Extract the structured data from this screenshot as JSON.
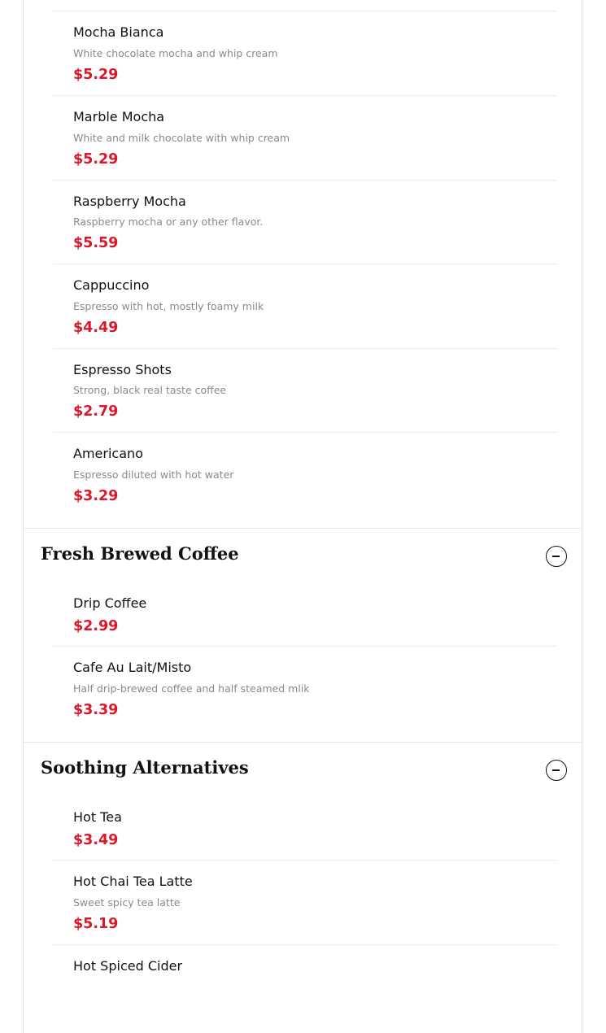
{
  "colors": {
    "price": "#d8182b",
    "text": "#111111",
    "description": "#8a8a8a",
    "divider": "#ececec"
  },
  "espresso_items": [
    {
      "name": "Mocha Bianca",
      "description": "White chocolate mocha and whip cream",
      "price": "$5.29"
    },
    {
      "name": "Marble Mocha",
      "description": "White and milk chocolate with whip cream",
      "price": "$5.29"
    },
    {
      "name": "Raspberry Mocha",
      "description": "Raspberry mocha or any other flavor.",
      "price": "$5.59"
    },
    {
      "name": "Cappuccino",
      "description": "Espresso with hot, mostly foamy milk",
      "price": "$4.49"
    },
    {
      "name": "Espresso Shots",
      "description": "Strong, black real taste coffee",
      "price": "$2.79"
    },
    {
      "name": "Americano",
      "description": "Espresso diluted with hot water",
      "price": "$3.29"
    }
  ],
  "fresh_brewed": {
    "title": "Fresh Brewed Coffee",
    "collapse_icon": "minus-circle-icon",
    "items": [
      {
        "name": "Drip Coffee",
        "price": "$2.99"
      },
      {
        "name": "Cafe Au Lait/Misto",
        "description": "Half drip-brewed coffee and half steamed mlik",
        "price": "$3.39"
      }
    ]
  },
  "soothing": {
    "title": "Soothing Alternatives",
    "collapse_icon": "minus-circle-icon",
    "items": [
      {
        "name": "Hot Tea",
        "price": "$3.49"
      },
      {
        "name": "Hot Chai Tea Latte",
        "description": "Sweet spicy tea latte",
        "price": "$5.19"
      },
      {
        "name": "Hot Spiced Cider"
      }
    ]
  }
}
